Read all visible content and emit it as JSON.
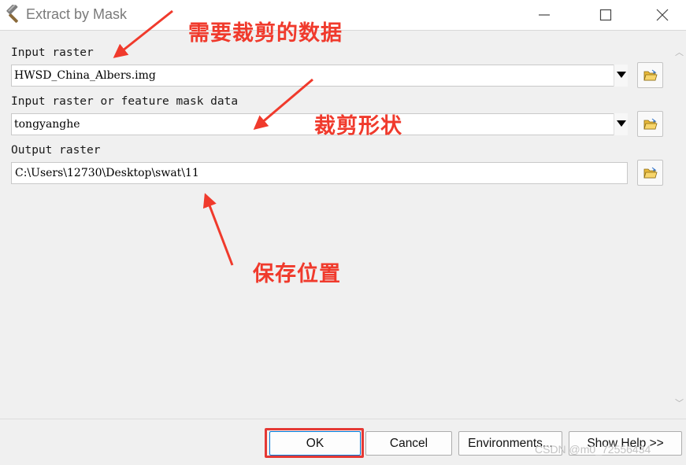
{
  "window": {
    "title": "Extract by Mask",
    "icon": "hammer-icon"
  },
  "params": [
    {
      "label": "Input raster",
      "value": "HWSD_China_Albers.img",
      "type": "combo"
    },
    {
      "label": "Input raster or feature mask data",
      "value": "tongyanghe",
      "type": "combo"
    },
    {
      "label": "Output raster",
      "value": "C:\\Users\\12730\\Desktop\\swat\\11",
      "type": "text"
    }
  ],
  "buttons": {
    "ok": "OK",
    "cancel": "Cancel",
    "environments": "Environments...",
    "help": "Show Help >>"
  },
  "annotations": {
    "data_to_clip": "需要裁剪的数据",
    "clip_shape": "裁剪形状",
    "save_location": "保存位置",
    "color": "#f03a2c"
  },
  "watermark": "CSDN @m0_72556434"
}
